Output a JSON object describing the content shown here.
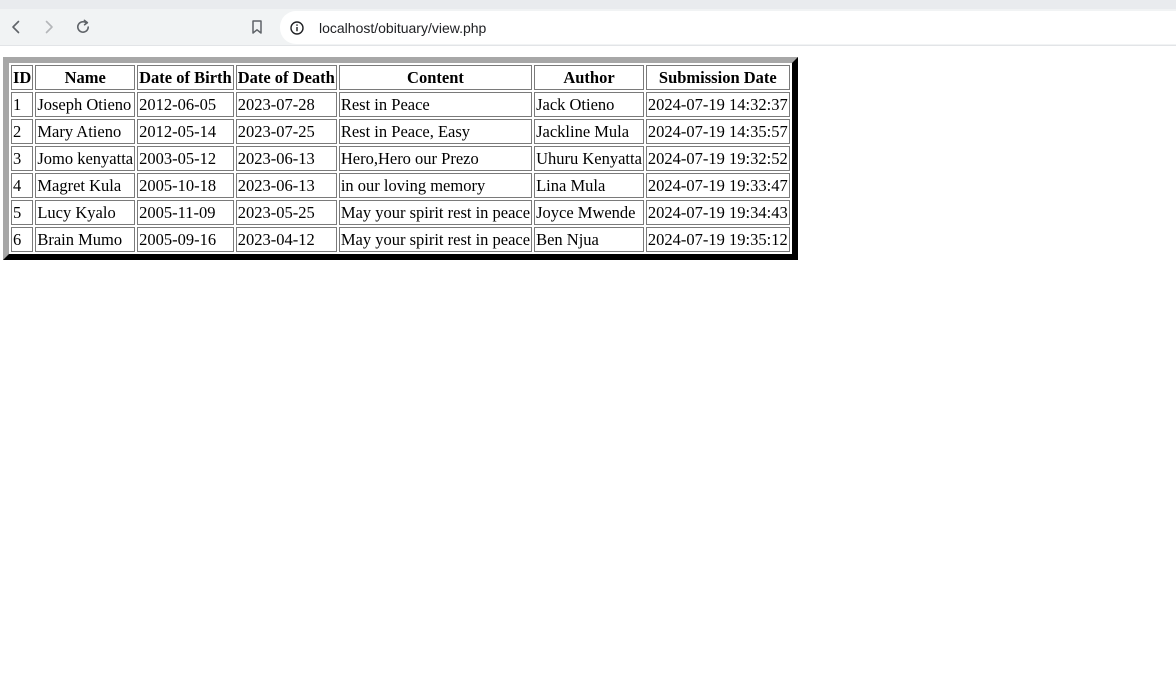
{
  "browser": {
    "url": "localhost/obituary/view.php"
  },
  "table": {
    "headers": [
      "ID",
      "Name",
      "Date of Birth",
      "Date of Death",
      "Content",
      "Author",
      "Submission Date"
    ],
    "rows": [
      [
        "1",
        "Joseph Otieno",
        "2012-06-05",
        "2023-07-28",
        "Rest in Peace",
        "Jack Otieno",
        "2024-07-19 14:32:37"
      ],
      [
        "2",
        "Mary Atieno",
        "2012-05-14",
        "2023-07-25",
        "Rest in Peace, Easy",
        "Jackline Mula",
        "2024-07-19 14:35:57"
      ],
      [
        "3",
        "Jomo kenyatta",
        "2003-05-12",
        "2023-06-13",
        "Hero,Hero our Prezo",
        "Uhuru Kenyatta",
        "2024-07-19 19:32:52"
      ],
      [
        "4",
        "Magret Kula",
        "2005-10-18",
        "2023-06-13",
        "in our loving memory",
        "Lina Mula",
        "2024-07-19 19:33:47"
      ],
      [
        "5",
        "Lucy Kyalo",
        "2005-11-09",
        "2023-05-25",
        "May your spirit rest in peace",
        "Joyce Mwende",
        "2024-07-19 19:34:43"
      ],
      [
        "6",
        "Brain Mumo",
        "2005-09-16",
        "2023-04-12",
        "May your spirit rest in peace",
        "Ben Njua",
        "2024-07-19 19:35:12"
      ]
    ]
  }
}
